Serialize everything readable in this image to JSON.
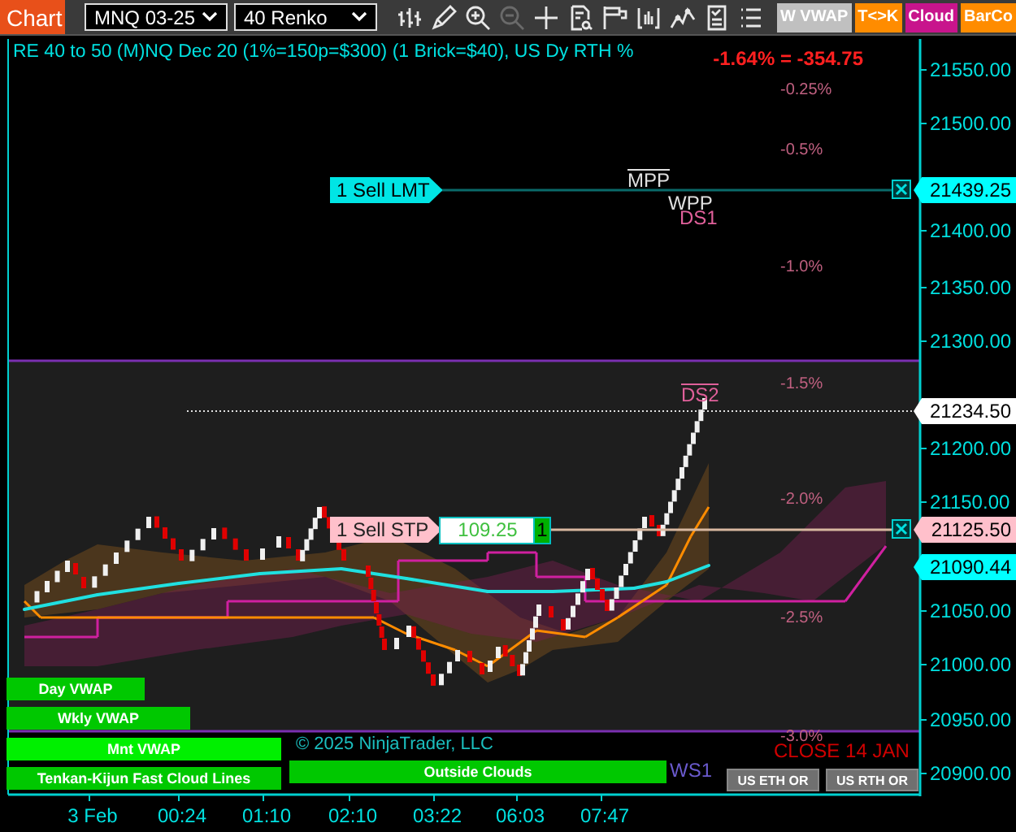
{
  "toolbar": {
    "app_button": "Chart",
    "instrument": "MNQ 03-25",
    "bar_type": "40 Renko",
    "tools": [
      {
        "kind": "bars",
        "disabled": false
      },
      {
        "kind": "pencil",
        "disabled": false
      },
      {
        "kind": "zoom-in",
        "disabled": false
      },
      {
        "kind": "zoom-out",
        "disabled": true
      },
      {
        "kind": "crosshair",
        "disabled": false
      },
      {
        "kind": "doc-search",
        "disabled": false
      },
      {
        "kind": "flag",
        "disabled": false
      },
      {
        "kind": "bracket-bars",
        "disabled": false
      },
      {
        "kind": "line-chart",
        "disabled": false
      },
      {
        "kind": "doc",
        "disabled": false
      },
      {
        "kind": "list",
        "disabled": false
      }
    ],
    "toggles": [
      {
        "label": "W VWAP",
        "color": "#c0c0c0"
      },
      {
        "label": "T<>K",
        "color": "#ff8c00"
      },
      {
        "label": "Cloud",
        "color": "#c8148c"
      },
      {
        "label": "BarCo",
        "color": "#ff8c00"
      }
    ]
  },
  "chart": {
    "title": "RE 40 to 50 (M)NQ Dec 20 (1%=150p=$300) (1 Brick=$40), US Dy RTH %",
    "pnl": "-1.64% = -354.75",
    "percent_levels": [
      "-0.25%",
      "-0.5%",
      "-1.0%",
      "-1.5%",
      "-2.0%",
      "-2.5%",
      "-3.0%"
    ],
    "level_labels": [
      {
        "text": "MPP",
        "color": "#e0e0e0"
      },
      {
        "text": "WPP",
        "color": "#e0e0e0"
      },
      {
        "text": "DS1",
        "color": "#e0609a"
      },
      {
        "text": "DS2",
        "color": "#e0609a"
      },
      {
        "text": "WS1",
        "color": "#6a5acd"
      },
      {
        "text": "CLOSE 14 JAN",
        "color": "#d00000"
      }
    ],
    "orders": [
      {
        "kind": "limit",
        "label": "1 Sell LMT"
      },
      {
        "kind": "stop",
        "label": "1 Sell STP",
        "pnl": "109.25",
        "quantity": "1"
      }
    ],
    "indicator_buttons": [
      {
        "label": "Day VWAP",
        "color": "#00c800"
      },
      {
        "label": "Wkly VWAP",
        "color": "#00c800"
      },
      {
        "label": "Mnt VWAP",
        "color": "#00f000"
      },
      {
        "label": "Tenkan-Kijun Fast Cloud Lines",
        "color": "#00c800"
      },
      {
        "label": "Outside Clouds",
        "color": "#00c800"
      }
    ],
    "copyright": "© 2025 NinjaTrader, LLC",
    "session_buttons": [
      "US ETH OR",
      "US RTH OR"
    ],
    "price_axis": [
      "21550.00",
      "21500.00",
      "21400.00",
      "21350.00",
      "21300.00",
      "21200.00",
      "21150.00",
      "21050.00",
      "21000.00",
      "20950.00",
      "20900.00"
    ],
    "price_markers": [
      {
        "text": "21439.25",
        "color": "#00ffff"
      },
      {
        "text": "21234.50",
        "color": "#ffffff"
      },
      {
        "text": "21125.50",
        "color": "#ffc0cb"
      },
      {
        "text": "21090.44",
        "color": "#00ffff"
      }
    ],
    "time_axis": [
      "3 Feb",
      "00:24",
      "01:10",
      "02:10",
      "03:22",
      "06:03",
      "07:47"
    ]
  }
}
